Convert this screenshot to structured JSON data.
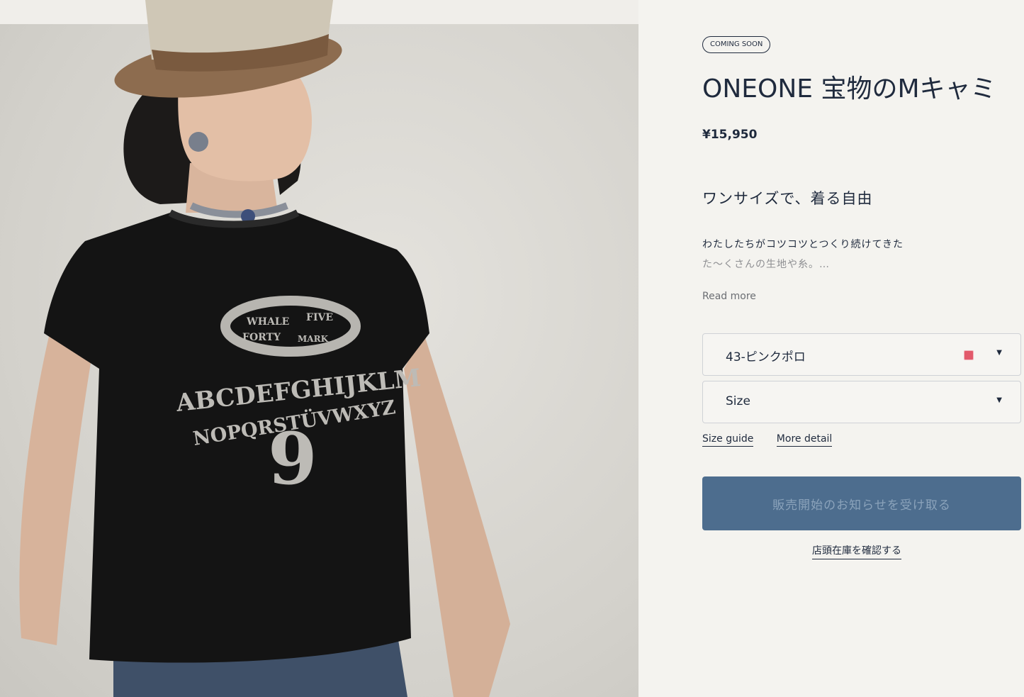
{
  "product": {
    "badge": "COMING SOON",
    "title": "ONEONE 宝物のMキャミ",
    "price": "¥15,950",
    "tagline": "ワンサイズで、着る自由",
    "description_line1": "わたしたちがコツコツとつくり続けてきた",
    "description_line2": "た～くさんの生地や糸。…",
    "read_more": "Read more"
  },
  "options": {
    "color_value": "43-ピンクポロ",
    "color_swatch": "#e25a6b",
    "size_placeholder": "Size"
  },
  "links": {
    "size_guide": "Size guide",
    "more_detail": "More detail"
  },
  "actions": {
    "notify_label": "販売開始のお知らせを受け取る",
    "store_stock": "店頭在庫を確認する"
  },
  "image": {
    "print_top_left": "WHALE",
    "print_top_right": "FIVE",
    "print_bottom_left": "FORTY",
    "print_bottom_right": "MARK",
    "print_arc_1": "ABCDEFGHIJKLM",
    "print_arc_2": "NOPQRSTÜVWXYZ",
    "print_number": "9"
  },
  "icons": {
    "dropdown": "caret-down-icon"
  }
}
